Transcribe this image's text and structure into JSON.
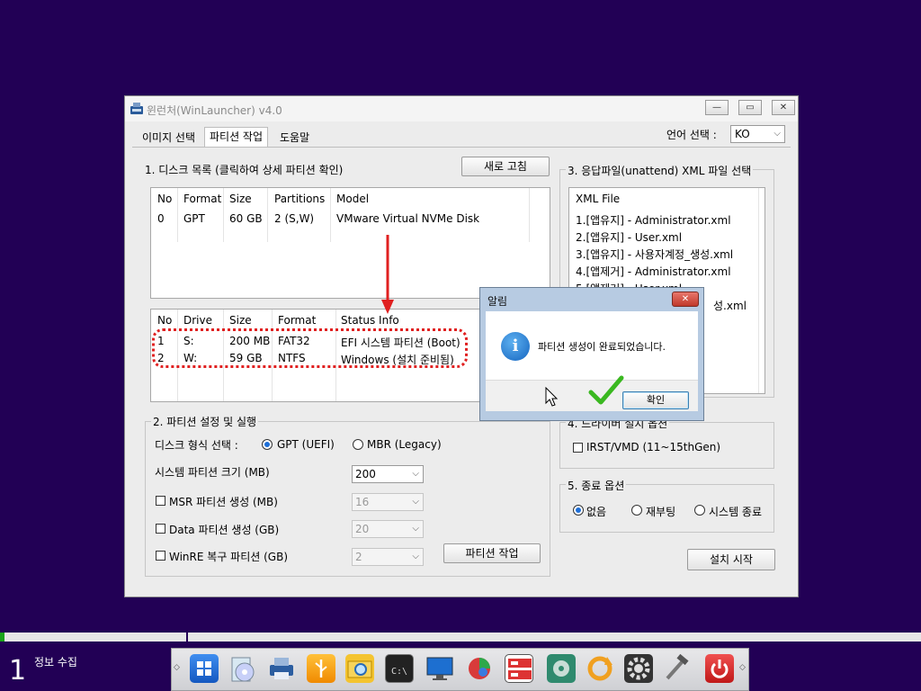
{
  "window": {
    "title": "윈런처(WinLauncher) v4.0",
    "controls": {
      "minimize": "—",
      "restore": "▭",
      "close": "✕"
    }
  },
  "tabs": [
    {
      "label": "이미지 선택"
    },
    {
      "label": "파티션 작업"
    },
    {
      "label": "도움말"
    }
  ],
  "language": {
    "label": "언어 선택 :",
    "value": "KO"
  },
  "disk_section": {
    "title": "1. 디스크 목록 (클릭하여 상세 파티션 확인)",
    "refresh_button": "새로 고침",
    "disk_table": {
      "headers": [
        "No",
        "Format",
        "Size",
        "Partitions",
        "Model"
      ],
      "rows": [
        [
          "0",
          "GPT",
          "60 GB",
          "2 (S,W)",
          "VMware Virtual NVMe Disk"
        ]
      ]
    },
    "partition_table": {
      "headers": [
        "No",
        "Drive",
        "Size",
        "Format",
        "Status Info"
      ],
      "rows": [
        [
          "1",
          "S:",
          "200 MB",
          "FAT32",
          "EFI 시스템 파티션 (Boot)"
        ],
        [
          "2",
          "W:",
          "59 GB",
          "NTFS",
          "Windows (설치 준비됨)"
        ]
      ]
    }
  },
  "partition_settings": {
    "title": "2. 파티션 설정 및 실행",
    "disk_format_label": "디스크 형식 선택 :",
    "gpt_option": "GPT (UEFI)",
    "mbr_option": "MBR (Legacy)",
    "system_size_label": "시스템 파티션 크기 (MB)",
    "system_size_value": "200",
    "msr_label": "MSR 파티션 생성 (MB)",
    "msr_value": "16",
    "data_label": "Data 파티션 생성 (GB)",
    "data_value": "20",
    "winre_label": "WinRE 복구 파티션 (GB)",
    "winre_value": "2",
    "run_button": "파티션 작업"
  },
  "xml_section": {
    "title": "3. 응답파일(unattend) XML 파일 선택",
    "header": "XML File",
    "items": [
      "1.[앱유지] - Administrator.xml",
      "2.[앱유지] - User.xml",
      "3.[앱유지] - 사용자계정_생성.xml",
      "4.[앱제거] - Administrator.xml",
      "5.[앱제거] - User.xml",
      "성.xml"
    ]
  },
  "driver_section": {
    "title": "4. 드라이버 설치 옵션",
    "checkbox_label": "IRST/VMD (11~15thGen)"
  },
  "exit_section": {
    "title": "5. 종료 옵션",
    "none": "없음",
    "reboot": "재부팅",
    "shutdown": "시스템 종료"
  },
  "install_button": "설치 시작",
  "dialog": {
    "title": "알림",
    "message": "파티션 생성이 완료되었습니다.",
    "ok_button": "확인",
    "info_glyph": "i",
    "close_glyph": "✕"
  },
  "status": {
    "step_number": "1",
    "step_label": "정보 수집",
    "progress": 0.005
  },
  "colors": {
    "desktop": "#220055",
    "accent": "#1e6fd8",
    "highlight_outline": "#e02020",
    "check_green": "#3ab820"
  },
  "dock_icons": [
    "windows-installer-icon",
    "cd-icon",
    "printer-icon",
    "usb-icon",
    "folder-search-icon",
    "terminal-icon",
    "monitor-icon",
    "partition-icon",
    "disk-manager-icon",
    "hdd-icon",
    "sync-icon",
    "settings-icon",
    "tools-icon",
    "power-icon"
  ]
}
